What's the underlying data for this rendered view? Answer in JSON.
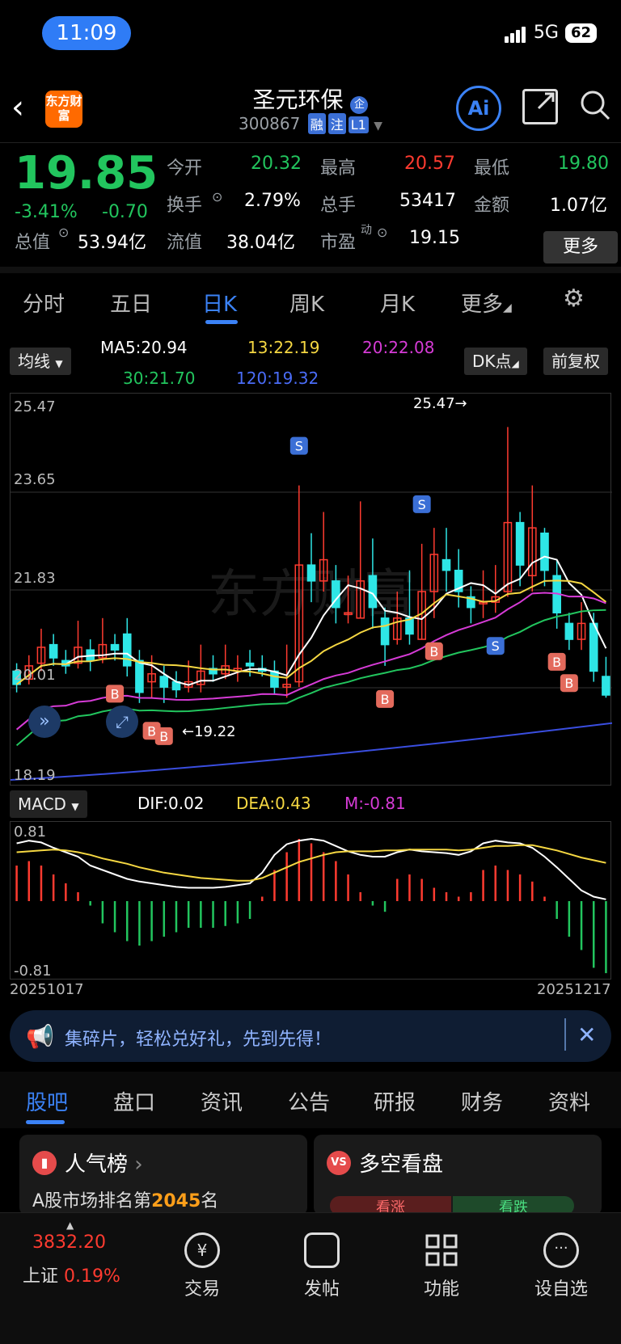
{
  "status": {
    "time": "11:09",
    "network": "5G",
    "battery": "62"
  },
  "header": {
    "title": "圣元环保",
    "code": "300867",
    "tags": [
      "融",
      "注",
      "L1"
    ],
    "logo": "东方财富",
    "ai": "Ai"
  },
  "quote": {
    "price": "19.85",
    "change_pct": "-3.41%",
    "change": "-0.70",
    "open_label": "今开",
    "open": "20.32",
    "high_label": "最高",
    "high": "20.57",
    "low_label": "最低",
    "low": "19.80",
    "turnover_label": "换手",
    "turnover": "2.79%",
    "volume_label": "总手",
    "volume": "53417",
    "amount_label": "金额",
    "amount": "1.07亿",
    "mktcap_label": "总值",
    "mktcap": "53.94亿",
    "float_label": "流值",
    "float": "38.04亿",
    "pe_label": "市盈",
    "pe_sup": "动",
    "pe": "19.15",
    "more": "更多"
  },
  "tabs": [
    "分时",
    "五日",
    "日K",
    "周K",
    "月K",
    "更多"
  ],
  "ma": {
    "selector": "均线",
    "ma5": "MA5:20.94",
    "ma13": "13:22.19",
    "ma20": "20:22.08",
    "ma30": "30:21.70",
    "ma120": "120:19.32",
    "dk": "DK点",
    "fq": "前复权"
  },
  "kchart": {
    "y_labels": [
      "25.47",
      "23.65",
      "21.83",
      "20.01",
      "18.19"
    ],
    "max_label": "25.47",
    "min_label": "19.22",
    "watermark": "东方财富"
  },
  "macd": {
    "selector": "MACD",
    "dif": "DIF:0.02",
    "dea": "DEA:0.43",
    "m": "M:-0.81",
    "top": "0.81",
    "bottom": "-0.81",
    "start": "20251017",
    "end": "20251217"
  },
  "banner": {
    "text": "集碎片，轻松兑好礼，先到先得！"
  },
  "bottom_tabs": [
    "股吧",
    "盘口",
    "资讯",
    "公告",
    "研报",
    "财务",
    "资料"
  ],
  "cards": {
    "left_title": "人气榜",
    "left_sub_prefix": "A股市场排名第",
    "left_rank": "2045",
    "left_sub_suffix": "名",
    "right_title": "多空看盘",
    "right_a": "看涨",
    "right_b": "看跌"
  },
  "bottom_bar": {
    "index_value": "3832.20",
    "index_name": "上证",
    "index_change": "0.19%",
    "trade": "交易",
    "post": "发帖",
    "func": "功能",
    "watch": "设自选"
  },
  "colors": {
    "up": "#ff3b30",
    "down": "#22c55e",
    "accent": "#3b82f6",
    "candle_down": "#2ee6e6"
  }
}
